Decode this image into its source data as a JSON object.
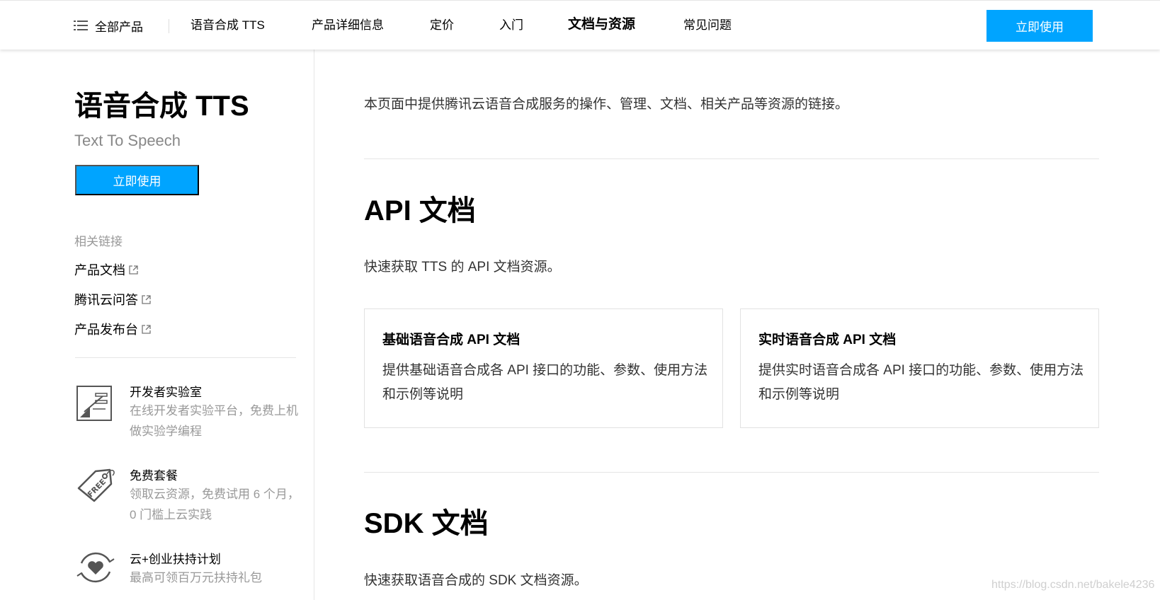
{
  "topbar": {
    "all_products_label": "全部产品",
    "nav_items": [
      "语音合成 TTS",
      "产品详细信息",
      "定价",
      "入门",
      "文档与资源",
      "常见问题"
    ],
    "active_nav": "文档与资源",
    "cta_label": "立即使用"
  },
  "sidebar": {
    "title": "语音合成 TTS",
    "subtitle": "Text To Speech",
    "cta_label": "立即使用",
    "related_heading": "相关链接",
    "related_links": [
      "产品文档",
      "腾讯云问答",
      "产品发布台"
    ],
    "promos": [
      {
        "icon": "developer-lab-icon",
        "title": "开发者实验室",
        "desc": "在线开发者实验平台，免费上机做实验学编程"
      },
      {
        "icon": "free-tag-icon",
        "title": "免费套餐",
        "desc": "领取云资源，免费试用 6 个月，0 门槛上云实践"
      },
      {
        "icon": "heart-cycle-icon",
        "title": "云+创业扶持计划",
        "desc": "最高可领百万元扶持礼包"
      }
    ]
  },
  "main": {
    "intro": "本页面中提供腾讯云语音合成服务的操作、管理、文档、相关产品等资源的链接。",
    "api_section": {
      "title": "API 文档",
      "desc": "快速获取 TTS 的 API 文档资源。",
      "cards": [
        {
          "title": "基础语音合成 API 文档",
          "desc": "提供基础语音合成各 API 接口的功能、参数、使用方法和示例等说明"
        },
        {
          "title": "实时语音合成 API 文档",
          "desc": "提供实时语音合成各 API 接口的功能、参数、使用方法和示例等说明"
        }
      ]
    },
    "sdk_section": {
      "title": "SDK 文档",
      "desc": "快速获取语音合成的 SDK 文档资源。"
    }
  },
  "watermark": "https://blog.csdn.net/bakele4236",
  "colors": {
    "accent": "#00a4ff",
    "muted": "#999999",
    "border": "#e5e5e5"
  }
}
